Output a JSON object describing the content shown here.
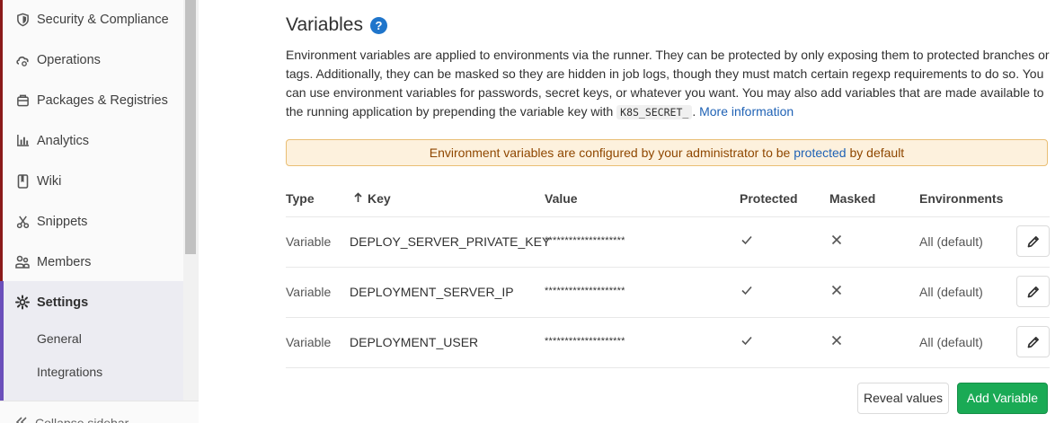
{
  "sidebar": {
    "items": [
      {
        "label": "Security & Compliance",
        "icon": "shield-icon"
      },
      {
        "label": "Operations",
        "icon": "cloud-gear-icon"
      },
      {
        "label": "Packages & Registries",
        "icon": "package-icon"
      },
      {
        "label": "Analytics",
        "icon": "chart-icon"
      },
      {
        "label": "Wiki",
        "icon": "book-icon"
      },
      {
        "label": "Snippets",
        "icon": "scissors-icon"
      },
      {
        "label": "Members",
        "icon": "users-icon"
      },
      {
        "label": "Settings",
        "icon": "gear-icon"
      }
    ],
    "sub_items": [
      "General",
      "Integrations"
    ],
    "collapse_label": "Collapse sidebar"
  },
  "main": {
    "title": "Variables",
    "desc_part1": "Environment variables are applied to environments via the runner. They can be protected by only exposing them to protected branches or tags. Additionally, they can be masked so they are hidden in job logs, though they must match certain regexp requirements to do so. You can use environment variables for passwords, secret keys, or whatever you want. You may also add variables that are made available to the running application by prepending the variable key with ",
    "desc_code": "K8S_SECRET_",
    "desc_part2": ". ",
    "more_info": "More information",
    "alert_part1": "Environment variables are configured by your administrator to be ",
    "alert_link": "protected",
    "alert_part2": " by default",
    "headers": {
      "type": "Type",
      "key": "Key",
      "value": "Value",
      "protected": "Protected",
      "masked": "Masked",
      "environments": "Environments"
    },
    "rows": [
      {
        "type": "Variable",
        "key": "DEPLOY_SERVER_PRIVATE_KEY",
        "value": "********************",
        "env": "All (default)"
      },
      {
        "type": "Variable",
        "key": "DEPLOYMENT_SERVER_IP",
        "value": "********************",
        "env": "All (default)"
      },
      {
        "type": "Variable",
        "key": "DEPLOYMENT_USER",
        "value": "********************",
        "env": "All (default)"
      }
    ],
    "reveal_label": "Reveal values",
    "add_label": "Add Variable"
  },
  "colors": {
    "accent": "#6b4fbb",
    "link": "#1f62b5",
    "success": "#1aaa55",
    "warning_bg": "#fdf1dd"
  }
}
